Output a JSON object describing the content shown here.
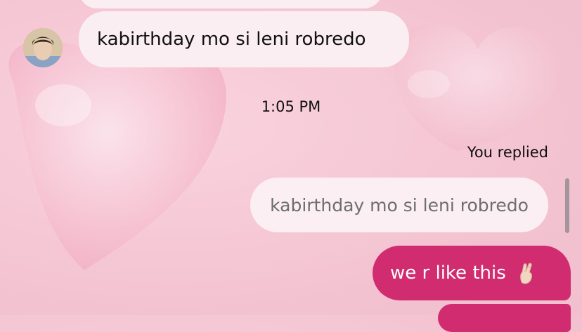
{
  "messages": {
    "incoming_text": "kabirthday mo si leni robredo",
    "timestamp": "1:05 PM",
    "replied_label": "You replied",
    "reply_quote_text": "kabirthday mo si leni robredo",
    "outgoing_text": "we r like this",
    "outgoing_emoji": "crossed-fingers-icon"
  },
  "colors": {
    "incoming_bubble": "#fbeef3",
    "outgoing_bubble": "#d12c70",
    "background": "#f6c9d6"
  }
}
